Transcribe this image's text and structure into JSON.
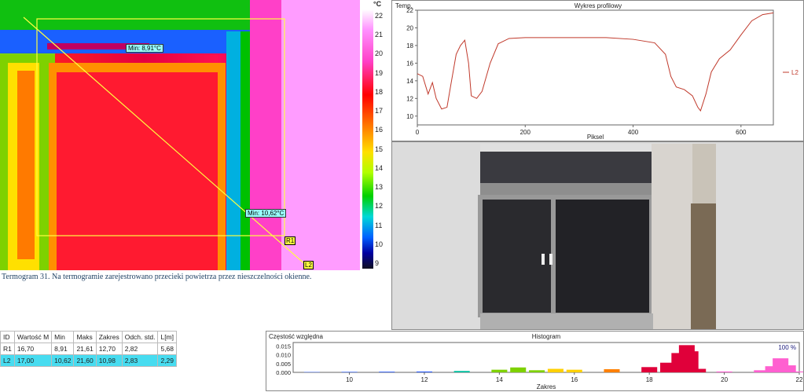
{
  "thermogram": {
    "min_r1": "Min: 8,91°C",
    "min_l2": "Min: 10,62°C",
    "r1_tag": "R1",
    "l2_tag": "L2"
  },
  "scale": {
    "unit": "°C",
    "ticks": [
      "22",
      "21",
      "20",
      "19",
      "18",
      "17",
      "16",
      "15",
      "14",
      "13",
      "12",
      "11",
      "10",
      "9"
    ]
  },
  "caption": "Termogram 31. Na termogramie zarejestrowano przecieki powietrza przez nieszczelności okienne.",
  "profile": {
    "y_axis_label": "Temp.",
    "title": "Wykres profilowy",
    "x_axis_label": "Piksel",
    "legend": "L2"
  },
  "stats": {
    "headers": [
      "ID",
      "Wartość M",
      "Min",
      "Maks",
      "Zakres",
      "Odch. std.",
      "L[m]"
    ],
    "rows": [
      [
        "R1",
        "16,70",
        "8,91",
        "21,61",
        "12,70",
        "2,82",
        "5,68"
      ],
      [
        "L2",
        "17,00",
        "10,62",
        "21,60",
        "10,98",
        "2,83",
        "2,29"
      ]
    ]
  },
  "histogram": {
    "y_axis_label": "Częstość względna",
    "title": "Histogram",
    "x_axis_label": "Zakres",
    "percent": "100 %"
  },
  "chart_data": [
    {
      "type": "line",
      "title": "Wykres profilowy",
      "xlabel": "Piksel",
      "ylabel": "Temp.",
      "xlim": [
        0,
        660
      ],
      "ylim": [
        9,
        22
      ],
      "x_ticks": [
        0,
        200,
        400,
        600
      ],
      "y_ticks": [
        10,
        12,
        14,
        16,
        18,
        20,
        22
      ],
      "series": [
        {
          "name": "L2",
          "color": "#c0392b",
          "x": [
            0,
            10,
            20,
            28,
            35,
            45,
            55,
            62,
            72,
            80,
            88,
            95,
            100,
            110,
            120,
            135,
            150,
            170,
            200,
            250,
            300,
            350,
            400,
            440,
            460,
            470,
            480,
            495,
            510,
            520,
            525,
            535,
            545,
            560,
            580,
            600,
            620,
            640,
            660
          ],
          "y": [
            14.8,
            14.5,
            12.5,
            13.8,
            12.0,
            10.8,
            11.0,
            13.5,
            17.0,
            18.0,
            18.6,
            16.0,
            12.3,
            12.0,
            12.8,
            16.0,
            18.2,
            18.8,
            18.9,
            18.9,
            18.9,
            18.9,
            18.7,
            18.3,
            17.0,
            14.5,
            13.3,
            13.0,
            12.3,
            11.0,
            10.6,
            12.5,
            15.0,
            16.5,
            17.5,
            19.2,
            20.8,
            21.5,
            21.7
          ]
        }
      ]
    },
    {
      "type": "area",
      "title": "Histogram",
      "xlabel": "Zakres",
      "ylabel": "Częstość względna",
      "xlim": [
        8.5,
        22
      ],
      "ylim": [
        0,
        0.017
      ],
      "x_ticks": [
        10,
        12,
        14,
        16,
        18,
        20,
        22
      ],
      "y_ticks": [
        0.0,
        0.005,
        0.01,
        0.015
      ],
      "x": [
        9,
        10,
        11,
        12,
        13,
        14,
        14.5,
        15,
        15.5,
        16,
        17,
        18,
        18.5,
        18.8,
        19.0,
        19.1,
        19.3,
        20,
        21,
        21.3,
        21.5,
        21.7,
        22
      ],
      "values": [
        0.0002,
        0.0003,
        0.0004,
        0.0005,
        0.0008,
        0.0015,
        0.0028,
        0.0012,
        0.002,
        0.0015,
        0.0018,
        0.003,
        0.0055,
        0.011,
        0.0155,
        0.012,
        0.002,
        0.0005,
        0.0012,
        0.0035,
        0.008,
        0.004,
        0.0005
      ]
    }
  ]
}
